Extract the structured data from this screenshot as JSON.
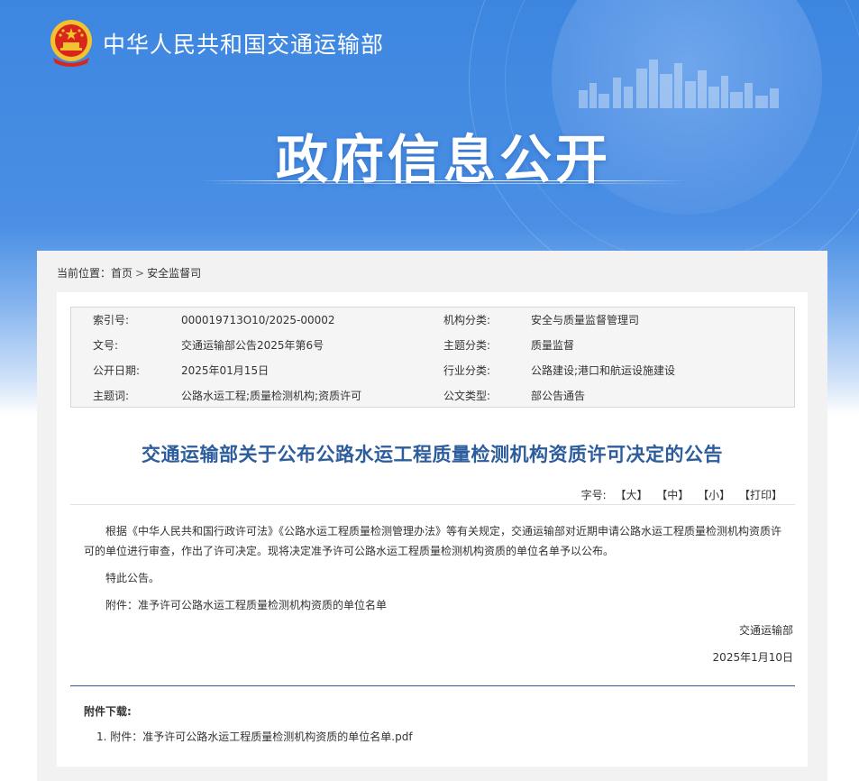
{
  "header": {
    "site_title": "中华人民共和国交通运输部",
    "section_title": "政府信息公开"
  },
  "breadcrumb": {
    "label": "当前位置：",
    "items": [
      "首页",
      "安全监督司"
    ],
    "separator": ">"
  },
  "meta": {
    "rows": [
      {
        "k1": "索引号:",
        "v1": "000019713O10/2025-00002",
        "k2": "机构分类:",
        "v2": "安全与质量监督管理司"
      },
      {
        "k1": "文号:",
        "v1": "交通运输部公告2025年第6号",
        "k2": "主题分类:",
        "v2": "质量监督"
      },
      {
        "k1": "公开日期:",
        "v1": "2025年01月15日",
        "k2": "行业分类:",
        "v2": "公路建设;港口和航运设施建设"
      },
      {
        "k1": "主题词:",
        "v1": "公路水运工程;质量检测机构;资质许可",
        "k2": "公文类型:",
        "v2": "部公告通告"
      }
    ]
  },
  "document": {
    "title": "交通运输部关于公布公路水运工程质量检测机构资质许可决定的公告",
    "font_size_label": "字号:",
    "font_size_options": [
      "【大】",
      "【中】",
      "【小】"
    ],
    "print_label": "【打印】",
    "paragraph1": "根据《中华人民共和国行政许可法》《公路水运工程质量检测管理办法》等有关规定，交通运输部对近期申请公路水运工程质量检测机构资质许可的单位进行审查，作出了许可决定。现将决定准予许可公路水运工程质量检测机构资质的单位名单予以公布。",
    "paragraph2": "特此公告。",
    "paragraph3": "附件：准予许可公路水运工程质量检测机构资质的单位名单",
    "signature": "交通运输部",
    "date": "2025年1月10日"
  },
  "attachments": {
    "title": "附件下载:",
    "items": [
      {
        "index": "1.",
        "label": "附件：准予许可公路水运工程质量检测机构资质的单位名单.pdf"
      }
    ]
  },
  "colors": {
    "banner_blue": "#3d86e0",
    "title_blue": "#2d5d9c"
  }
}
